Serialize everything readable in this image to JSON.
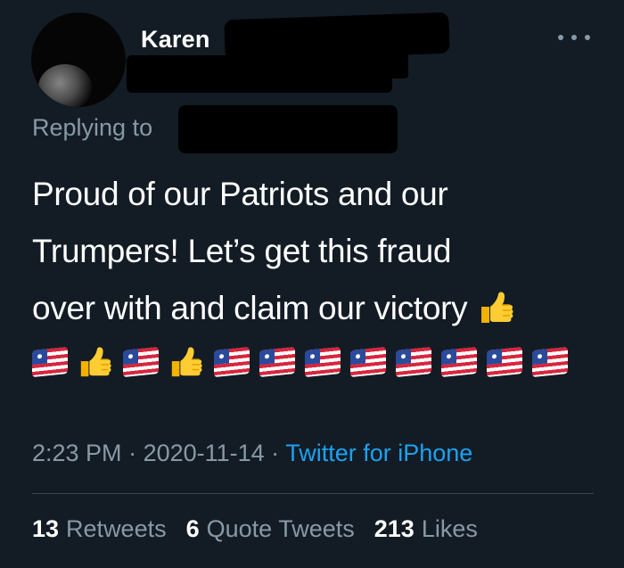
{
  "header": {
    "display_name": "Karen",
    "more_icon": "more-horizontal-icon"
  },
  "reply": {
    "replying_to_label": "Replying to"
  },
  "tweet": {
    "line1": "Proud of our Patriots and our",
    "line2": "Trumpers!  Let’s get this fraud",
    "line3": "over with and claim our victory",
    "emoji_sequence": [
      "flag-icon",
      "thumbs-up-icon",
      "flag-icon",
      "thumbs-up-icon",
      "flag-icon",
      "flag-icon",
      "flag-icon",
      "flag-icon",
      "flag-icon",
      "flag-icon",
      "flag-icon",
      "flag-icon"
    ]
  },
  "meta": {
    "time": "2:23 PM",
    "separator": " · ",
    "date": "2020-11-14",
    "source": "Twitter for iPhone"
  },
  "stats": {
    "retweets_count": "13",
    "retweets_label": "Retweets",
    "quotes_count": "6",
    "quotes_label": "Quote Tweets",
    "likes_count": "213",
    "likes_label": "Likes"
  },
  "colors": {
    "background": "#131c25",
    "muted_text": "#8899a6",
    "link": "#1da1f2",
    "divider": "#38444d"
  }
}
